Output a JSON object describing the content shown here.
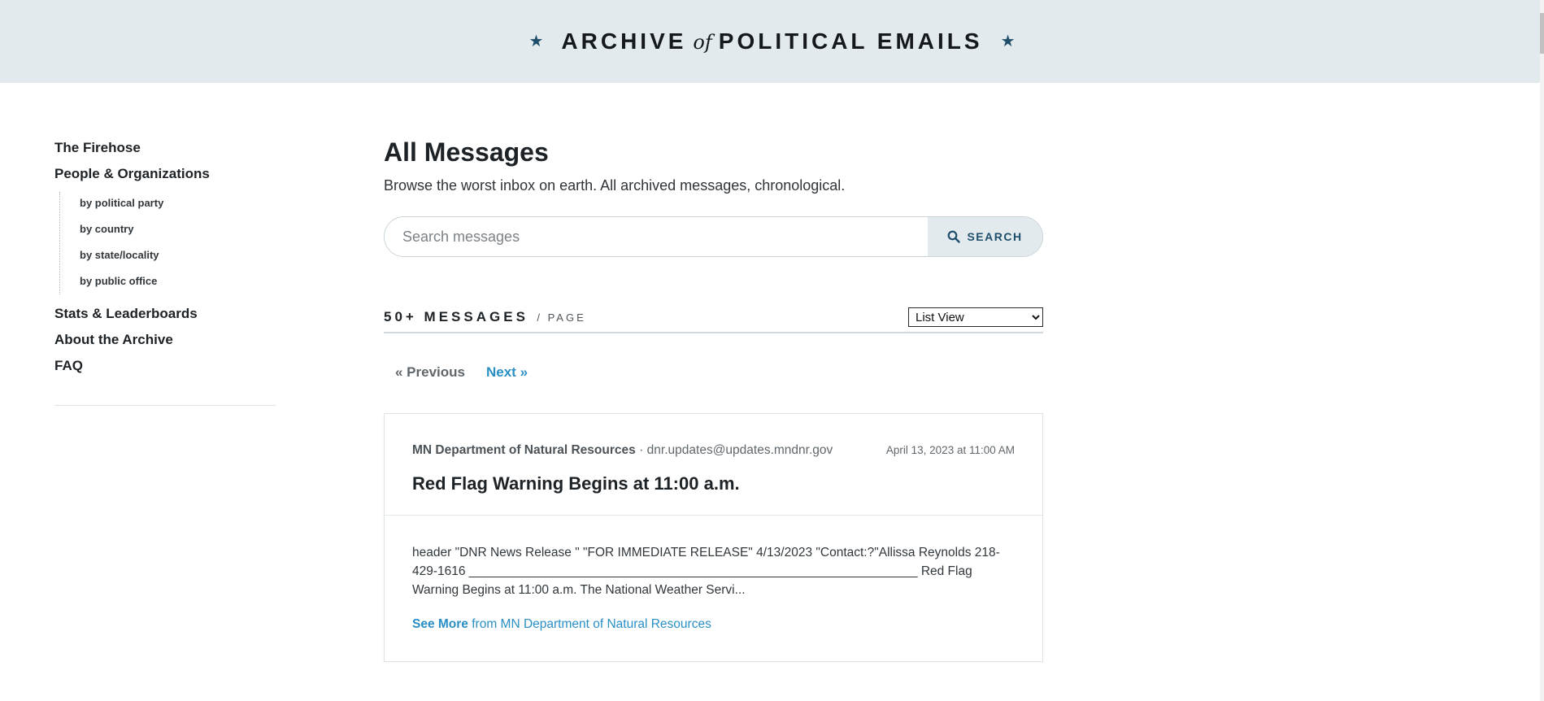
{
  "site": {
    "title_part1": "ARCHIVE",
    "title_of": "of",
    "title_part2": "POLITICAL EMAILS"
  },
  "sidebar": {
    "items": [
      {
        "label": "The Firehose"
      },
      {
        "label": "People & Organizations"
      }
    ],
    "subitems": [
      {
        "label": "by political party"
      },
      {
        "label": "by country"
      },
      {
        "label": "by state/locality"
      },
      {
        "label": "by public office"
      }
    ],
    "items_after": [
      {
        "label": "Stats & Leaderboards"
      },
      {
        "label": "About the Archive"
      },
      {
        "label": "FAQ"
      }
    ]
  },
  "main": {
    "title": "All Messages",
    "subtitle": "Browse the worst inbox on earth. All archived messages, chronological.",
    "search": {
      "placeholder": "Search messages",
      "button_label": "SEARCH"
    },
    "count_label": "50+ MESSAGES",
    "count_suffix": "/ PAGE",
    "view": {
      "selected": "List View"
    },
    "pager": {
      "prev": "« Previous",
      "next": "Next »"
    },
    "messages": [
      {
        "sender": "MN Department of Natural Resources",
        "email": "· dnr.updates@updates.mndnr.gov",
        "date": "April 13, 2023 at 11:00 AM",
        "title": "Red Flag Warning Begins at 11:00 a.m.",
        "preview": "header \"DNR News Release \" \"FOR IMMEDIATE RELEASE\" 4/13/2023 \"Contact:?\"Allissa Reynolds 218-429-1616 ________________________________________________________________ Red Flag Warning Begins at 11:00 a.m. The National Weather Servi...",
        "see_more": "See More",
        "see_more_from": " from MN Department of Natural Resources"
      }
    ]
  },
  "colors": {
    "header_bg": "#e2eaee",
    "accent_navy": "#1f4e6b",
    "link_blue": "#2a8fc4"
  }
}
